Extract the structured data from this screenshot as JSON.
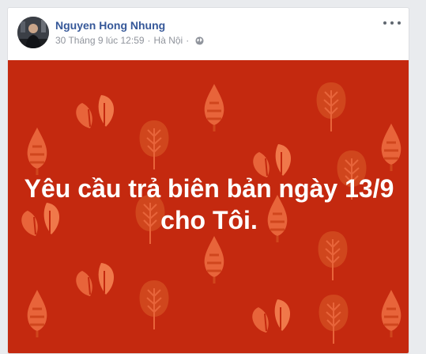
{
  "post": {
    "author": "Nguyen Hong Nhung",
    "date": "30 Tháng 9 lúc 12:59",
    "separator": "·",
    "location": "Hà Nội",
    "privacy_icon": "globe-icon",
    "options_icon": "more-options-icon",
    "text_line1": "Yêu cầu trả biên bản ngày 13/9",
    "text_line2": "cho Tôi."
  },
  "colors": {
    "banner_background": "#c4290f",
    "leaf_light": "#e8643a",
    "leaf_dark": "#d0461d",
    "author_link": "#365899",
    "meta_text": "#90949c"
  }
}
